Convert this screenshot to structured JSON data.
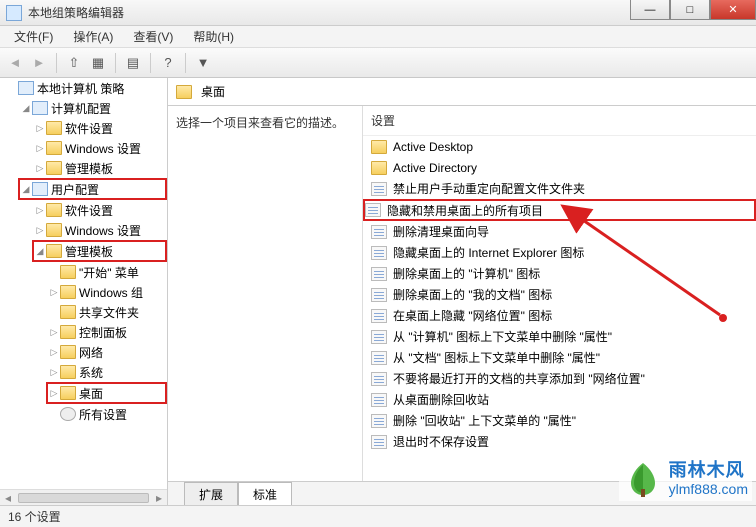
{
  "window": {
    "title": "本地组策略编辑器"
  },
  "menus": {
    "file": "文件(F)",
    "action": "操作(A)",
    "view": "查看(V)",
    "help": "帮助(H)"
  },
  "tree": {
    "root": "本地计算机 策略",
    "computer_cfg": "计算机配置",
    "cc_software": "软件设置",
    "cc_windows": "Windows 设置",
    "cc_admin": "管理模板",
    "user_cfg": "用户配置",
    "uc_software": "软件设置",
    "uc_windows": "Windows 设置",
    "uc_admin": "管理模板",
    "start_menu": "\"开始\" 菜单",
    "win_comp": "Windows 组",
    "shared": "共享文件夹",
    "control_panel": "控制面板",
    "network": "网络",
    "system": "系统",
    "desktop": "桌面",
    "all_settings": "所有设置"
  },
  "header": {
    "title": "桌面"
  },
  "desc": {
    "text": "选择一个项目来查看它的描述。"
  },
  "settings": {
    "head": "设置",
    "items": [
      {
        "type": "folder",
        "label": "Active Desktop"
      },
      {
        "type": "folder",
        "label": "Active Directory"
      },
      {
        "type": "policy",
        "label": "禁止用户手动重定向配置文件文件夹"
      },
      {
        "type": "policy",
        "label": "隐藏和禁用桌面上的所有项目",
        "highlight": true
      },
      {
        "type": "policy",
        "label": "删除清理桌面向导"
      },
      {
        "type": "policy",
        "label": "隐藏桌面上的 Internet Explorer 图标"
      },
      {
        "type": "policy",
        "label": "删除桌面上的 \"计算机\" 图标"
      },
      {
        "type": "policy",
        "label": "删除桌面上的 \"我的文档\" 图标"
      },
      {
        "type": "policy",
        "label": "在桌面上隐藏 \"网络位置\" 图标"
      },
      {
        "type": "policy",
        "label": "从 \"计算机\" 图标上下文菜单中删除 \"属性\""
      },
      {
        "type": "policy",
        "label": "从 \"文档\" 图标上下文菜单中删除 \"属性\""
      },
      {
        "type": "policy",
        "label": "不要将最近打开的文档的共享添加到 \"网络位置\""
      },
      {
        "type": "policy",
        "label": "从桌面删除回收站"
      },
      {
        "type": "policy",
        "label": "删除 \"回收站\" 上下文菜单的 \"属性\""
      },
      {
        "type": "policy",
        "label": "退出时不保存设置"
      }
    ]
  },
  "tabs": {
    "extended": "扩展",
    "standard": "标准"
  },
  "status": {
    "text": "16 个设置"
  },
  "watermark": {
    "cn": "雨林木风",
    "url": "ylmf888.com"
  }
}
